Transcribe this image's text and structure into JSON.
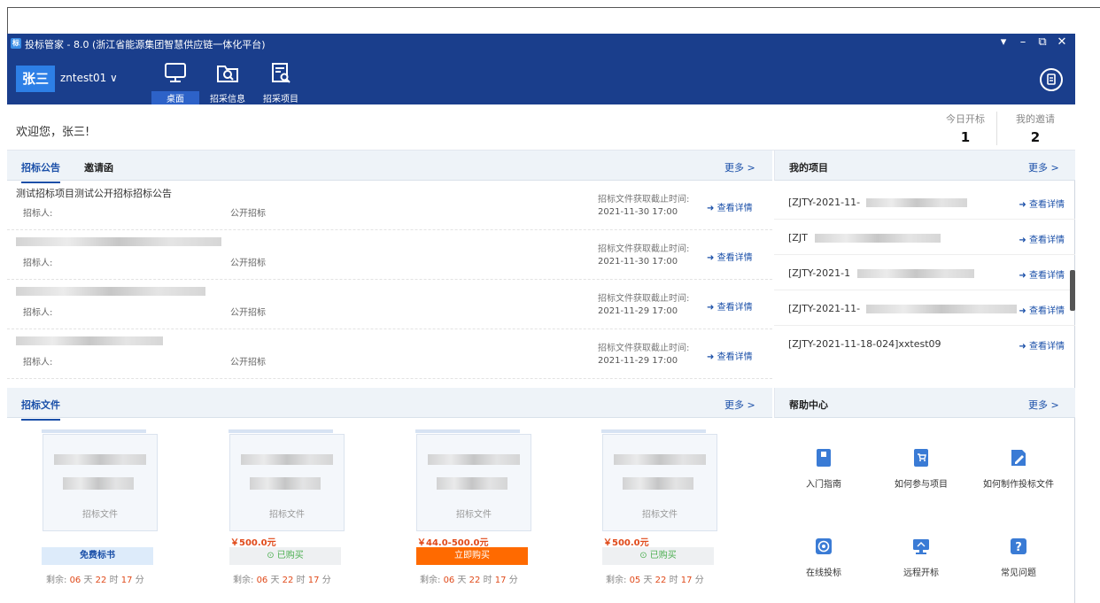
{
  "window": {
    "title": "投标管家 - 8.0 (浙江省能源集团智慧供应链一体化平台)",
    "logo_text": "标",
    "controls": [
      "▾",
      "–",
      "⧉",
      "✕"
    ]
  },
  "toolbar": {
    "avatar_text": "张三",
    "user_label": "zntest01 ∨",
    "nav": [
      {
        "label": "桌面",
        "icon": "desktop-icon"
      },
      {
        "label": "招采信息",
        "icon": "folder-search-icon"
      },
      {
        "label": "招采项目",
        "icon": "document-search-icon"
      }
    ],
    "notes_icon": "clipboard-icon"
  },
  "welcome": {
    "greeting": "欢迎您，张三!",
    "stats": [
      {
        "label": "今日开标",
        "value": "1"
      },
      {
        "label": "我的邀请",
        "value": "2"
      }
    ]
  },
  "announcements": {
    "tabs": [
      "招标公告",
      "邀请函"
    ],
    "more": "更多 >",
    "deadline_label": "招标文件获取截止时间:",
    "tenderer_label": "招标人:",
    "view_label": "查看详情",
    "rows": [
      {
        "title": "测试招标项目测试公开招标招标公告",
        "mode": "公开招标",
        "deadline": "2021-11-30 17:00"
      },
      {
        "title": "",
        "mode": "公开招标",
        "deadline": "2021-11-30 17:00"
      },
      {
        "title": "",
        "mode": "公开招标",
        "deadline": "2021-11-29 17:00"
      },
      {
        "title": "",
        "mode": "公开招标",
        "deadline": "2021-11-29 17:00"
      }
    ]
  },
  "projects": {
    "title": "我的项目",
    "more": "更多 >",
    "view_label": "查看详情",
    "rows": [
      {
        "code": "[ZJTY-2021-11-"
      },
      {
        "code": "[ZJT"
      },
      {
        "code": "[ZJTY-2021-1"
      },
      {
        "code": "[ZJTY-2021-11-"
      },
      {
        "code": "[ZJTY-2021-11-18-024]xxtest09"
      }
    ]
  },
  "documents": {
    "title": "招标文件",
    "more": "更多 >",
    "cards": [
      {
        "caption": "招标文件",
        "price": "",
        "button": "免费标书",
        "button_type": "free",
        "remain": {
          "prefix": "剩余:",
          "d": "06",
          "h": "22",
          "m": "17"
        }
      },
      {
        "caption": "招标文件",
        "price": "￥500.0元",
        "button": "⊙ 已购买",
        "button_type": "bought",
        "remain": {
          "prefix": "剩余:",
          "d": "06",
          "h": "22",
          "m": "17"
        }
      },
      {
        "caption": "招标文件",
        "price": "￥44.0-500.0元",
        "button": "立即购买",
        "button_type": "buy",
        "remain": {
          "prefix": "剩余:",
          "d": "06",
          "h": "22",
          "m": "17"
        }
      },
      {
        "caption": "招标文件",
        "price": "￥500.0元",
        "button": "⊙ 已购买",
        "button_type": "bought",
        "remain": {
          "prefix": "剩余:",
          "d": "05",
          "h": "22",
          "m": "17"
        }
      }
    ],
    "units": {
      "d": "天",
      "h": "时",
      "m": "分"
    }
  },
  "help": {
    "title": "帮助中心",
    "more": "更多 >",
    "items": [
      {
        "label": "入门指南",
        "icon": "book-icon",
        "color": "#3a7bd5"
      },
      {
        "label": "如何参与项目",
        "icon": "cart-doc-icon",
        "color": "#3a7bd5"
      },
      {
        "label": "如何制作投标文件",
        "icon": "edit-doc-icon",
        "color": "#3a7bd5"
      },
      {
        "label": "在线投标",
        "icon": "target-icon",
        "color": "#3a7bd5"
      },
      {
        "label": "远程开标",
        "icon": "monitor-icon",
        "color": "#3a7bd5"
      },
      {
        "label": "常见问题",
        "icon": "question-icon",
        "color": "#3a7bd5"
      }
    ]
  }
}
